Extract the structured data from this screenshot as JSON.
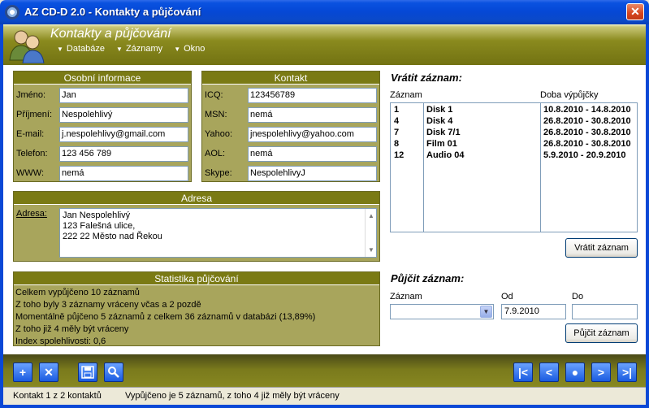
{
  "window": {
    "title": "AZ CD-D 2.0 - Kontakty a půjčování",
    "close_label": "✕"
  },
  "header": {
    "title": "Kontakty a půjčování"
  },
  "menu": {
    "items": [
      "Databáze",
      "Záznamy",
      "Okno"
    ]
  },
  "personal": {
    "title": "Osobní informace",
    "fields": [
      {
        "label": "Jméno:",
        "value": "Jan"
      },
      {
        "label": "Příjmení:",
        "value": "Nespolehlivý"
      },
      {
        "label": "E-mail:",
        "value": "j.nespolehlivy@gmail.com"
      },
      {
        "label": "Telefon:",
        "value": "123 456 789"
      },
      {
        "label": "WWW:",
        "value": "nemá"
      }
    ]
  },
  "contact": {
    "title": "Kontakt",
    "fields": [
      {
        "label": "ICQ:",
        "value": "123456789"
      },
      {
        "label": "MSN:",
        "value": "nemá"
      },
      {
        "label": "Yahoo:",
        "value": "jnespolehlivy@yahoo.com"
      },
      {
        "label": "AOL:",
        "value": "nemá"
      },
      {
        "label": "Skype:",
        "value": "NespolehlivyJ"
      }
    ]
  },
  "address": {
    "title": "Adresa",
    "label": "Adresa:",
    "lines": [
      "Jan Nespolehlivý",
      "123 Falešná ulice,",
      "222 22 Město nad Řekou"
    ]
  },
  "stats": {
    "title": "Statistika půjčování",
    "lines": [
      "Celkem vypůjčeno 10 záznamů",
      "Z toho byly 3 záznamy vráceny včas a 2 pozdě",
      "Momentálně půjčeno 5 záznamů z celkem 36 záznamů v databázi (13,89%)",
      "Z toho již 4 měly být vráceny",
      "Index spolehlivosti: 0,6"
    ]
  },
  "return": {
    "title": "Vrátit záznam:",
    "col_record": "Záznam",
    "col_period": "Doba výpůjčky",
    "rows": [
      {
        "id": "1",
        "name": "Disk 1",
        "period": "10.8.2010 - 14.8.2010"
      },
      {
        "id": "4",
        "name": "Disk 4",
        "period": "26.8.2010 - 30.8.2010"
      },
      {
        "id": "7",
        "name": "Disk 7/1",
        "period": "26.8.2010 - 30.8.2010"
      },
      {
        "id": "8",
        "name": "Film 01",
        "period": "26.8.2010 - 30.8.2010"
      },
      {
        "id": "12",
        "name": "Audio 04",
        "period": "5.9.2010 - 20.9.2010"
      }
    ],
    "button": "Vrátit záznam"
  },
  "borrow": {
    "title": "Půjčit záznam:",
    "label_record": "Záznam",
    "label_from": "Od",
    "label_to": "Do",
    "record_value": "",
    "from_value": "7.9.2010",
    "to_value": "",
    "button": "Půjčit záznam"
  },
  "status": {
    "left": "Kontakt 1 z 2 kontaktů",
    "right": "Vypůjčeno je 5 záznamů, z toho 4 již měly být vráceny"
  }
}
